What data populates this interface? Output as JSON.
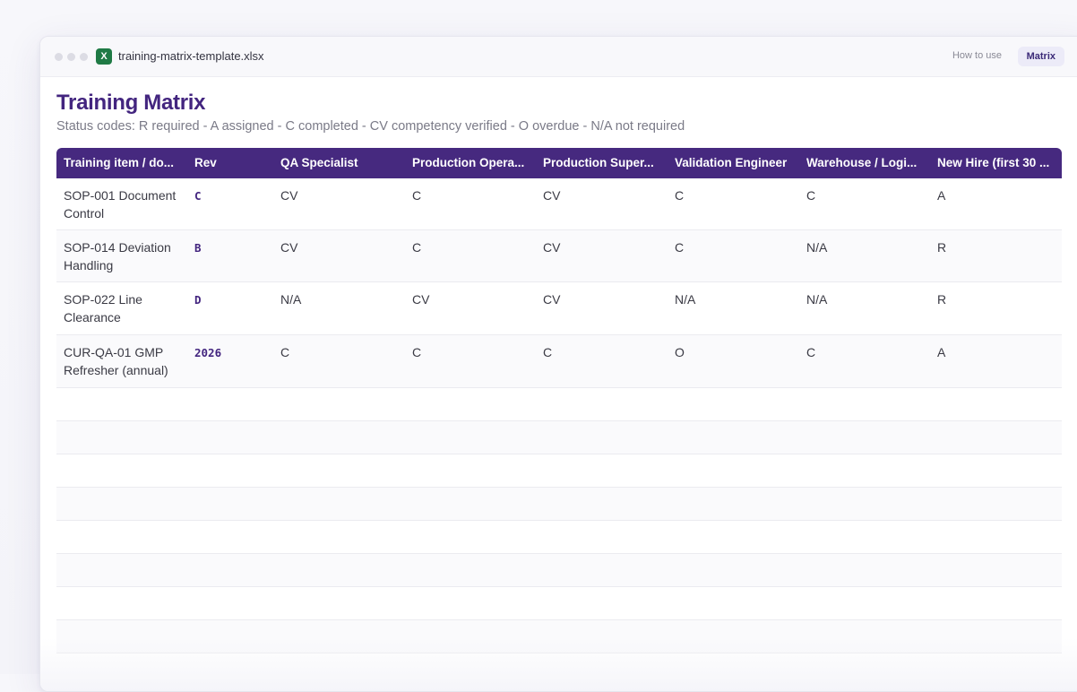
{
  "window": {
    "filename": "training-matrix-template.xlsx",
    "file_icon_letter": "X",
    "tabs": [
      {
        "label": "How to use",
        "active": false
      },
      {
        "label": "Matrix",
        "active": true
      }
    ]
  },
  "sheet": {
    "title": "Training Matrix",
    "subtitle": "Status codes: R required - A assigned - C completed - CV competency verified - O overdue - N/A not required"
  },
  "table": {
    "headers": [
      "Training item / do...",
      "Rev",
      "QA Specialist",
      "Production Opera...",
      "Production Super...",
      "Validation Engineer",
      "Warehouse / Logi...",
      "New Hire (first 30 ..."
    ],
    "rows": [
      {
        "item": "SOP-001 Document Control",
        "item_line1": "SOP-001 Document",
        "item_line2": "Control",
        "rev": "C",
        "cells": [
          "CV",
          "C",
          "CV",
          "C",
          "C",
          "A"
        ]
      },
      {
        "item": "SOP-014 Deviation Handling",
        "item_line1": "SOP-014 Deviation",
        "item_line2": "Handling",
        "rev": "B",
        "cells": [
          "CV",
          "C",
          "CV",
          "C",
          "N/A",
          "R"
        ]
      },
      {
        "item": "SOP-022 Line Clearance",
        "item_line1": "SOP-022 Line",
        "item_line2": "Clearance",
        "rev": "D",
        "cells": [
          "N/A",
          "CV",
          "CV",
          "N/A",
          "N/A",
          "R"
        ]
      },
      {
        "item": "CUR-QA-01 GMP Refresher (annual)",
        "item_line1": "CUR-QA-01 GMP",
        "item_line2": "Refresher (annual)",
        "rev": "2026",
        "cells": [
          "C",
          "C",
          "C",
          "O",
          "C",
          "A"
        ]
      }
    ]
  },
  "colors": {
    "header_bg": "#46297f",
    "title": "#43257f",
    "excel_icon": "#1f7a45"
  }
}
